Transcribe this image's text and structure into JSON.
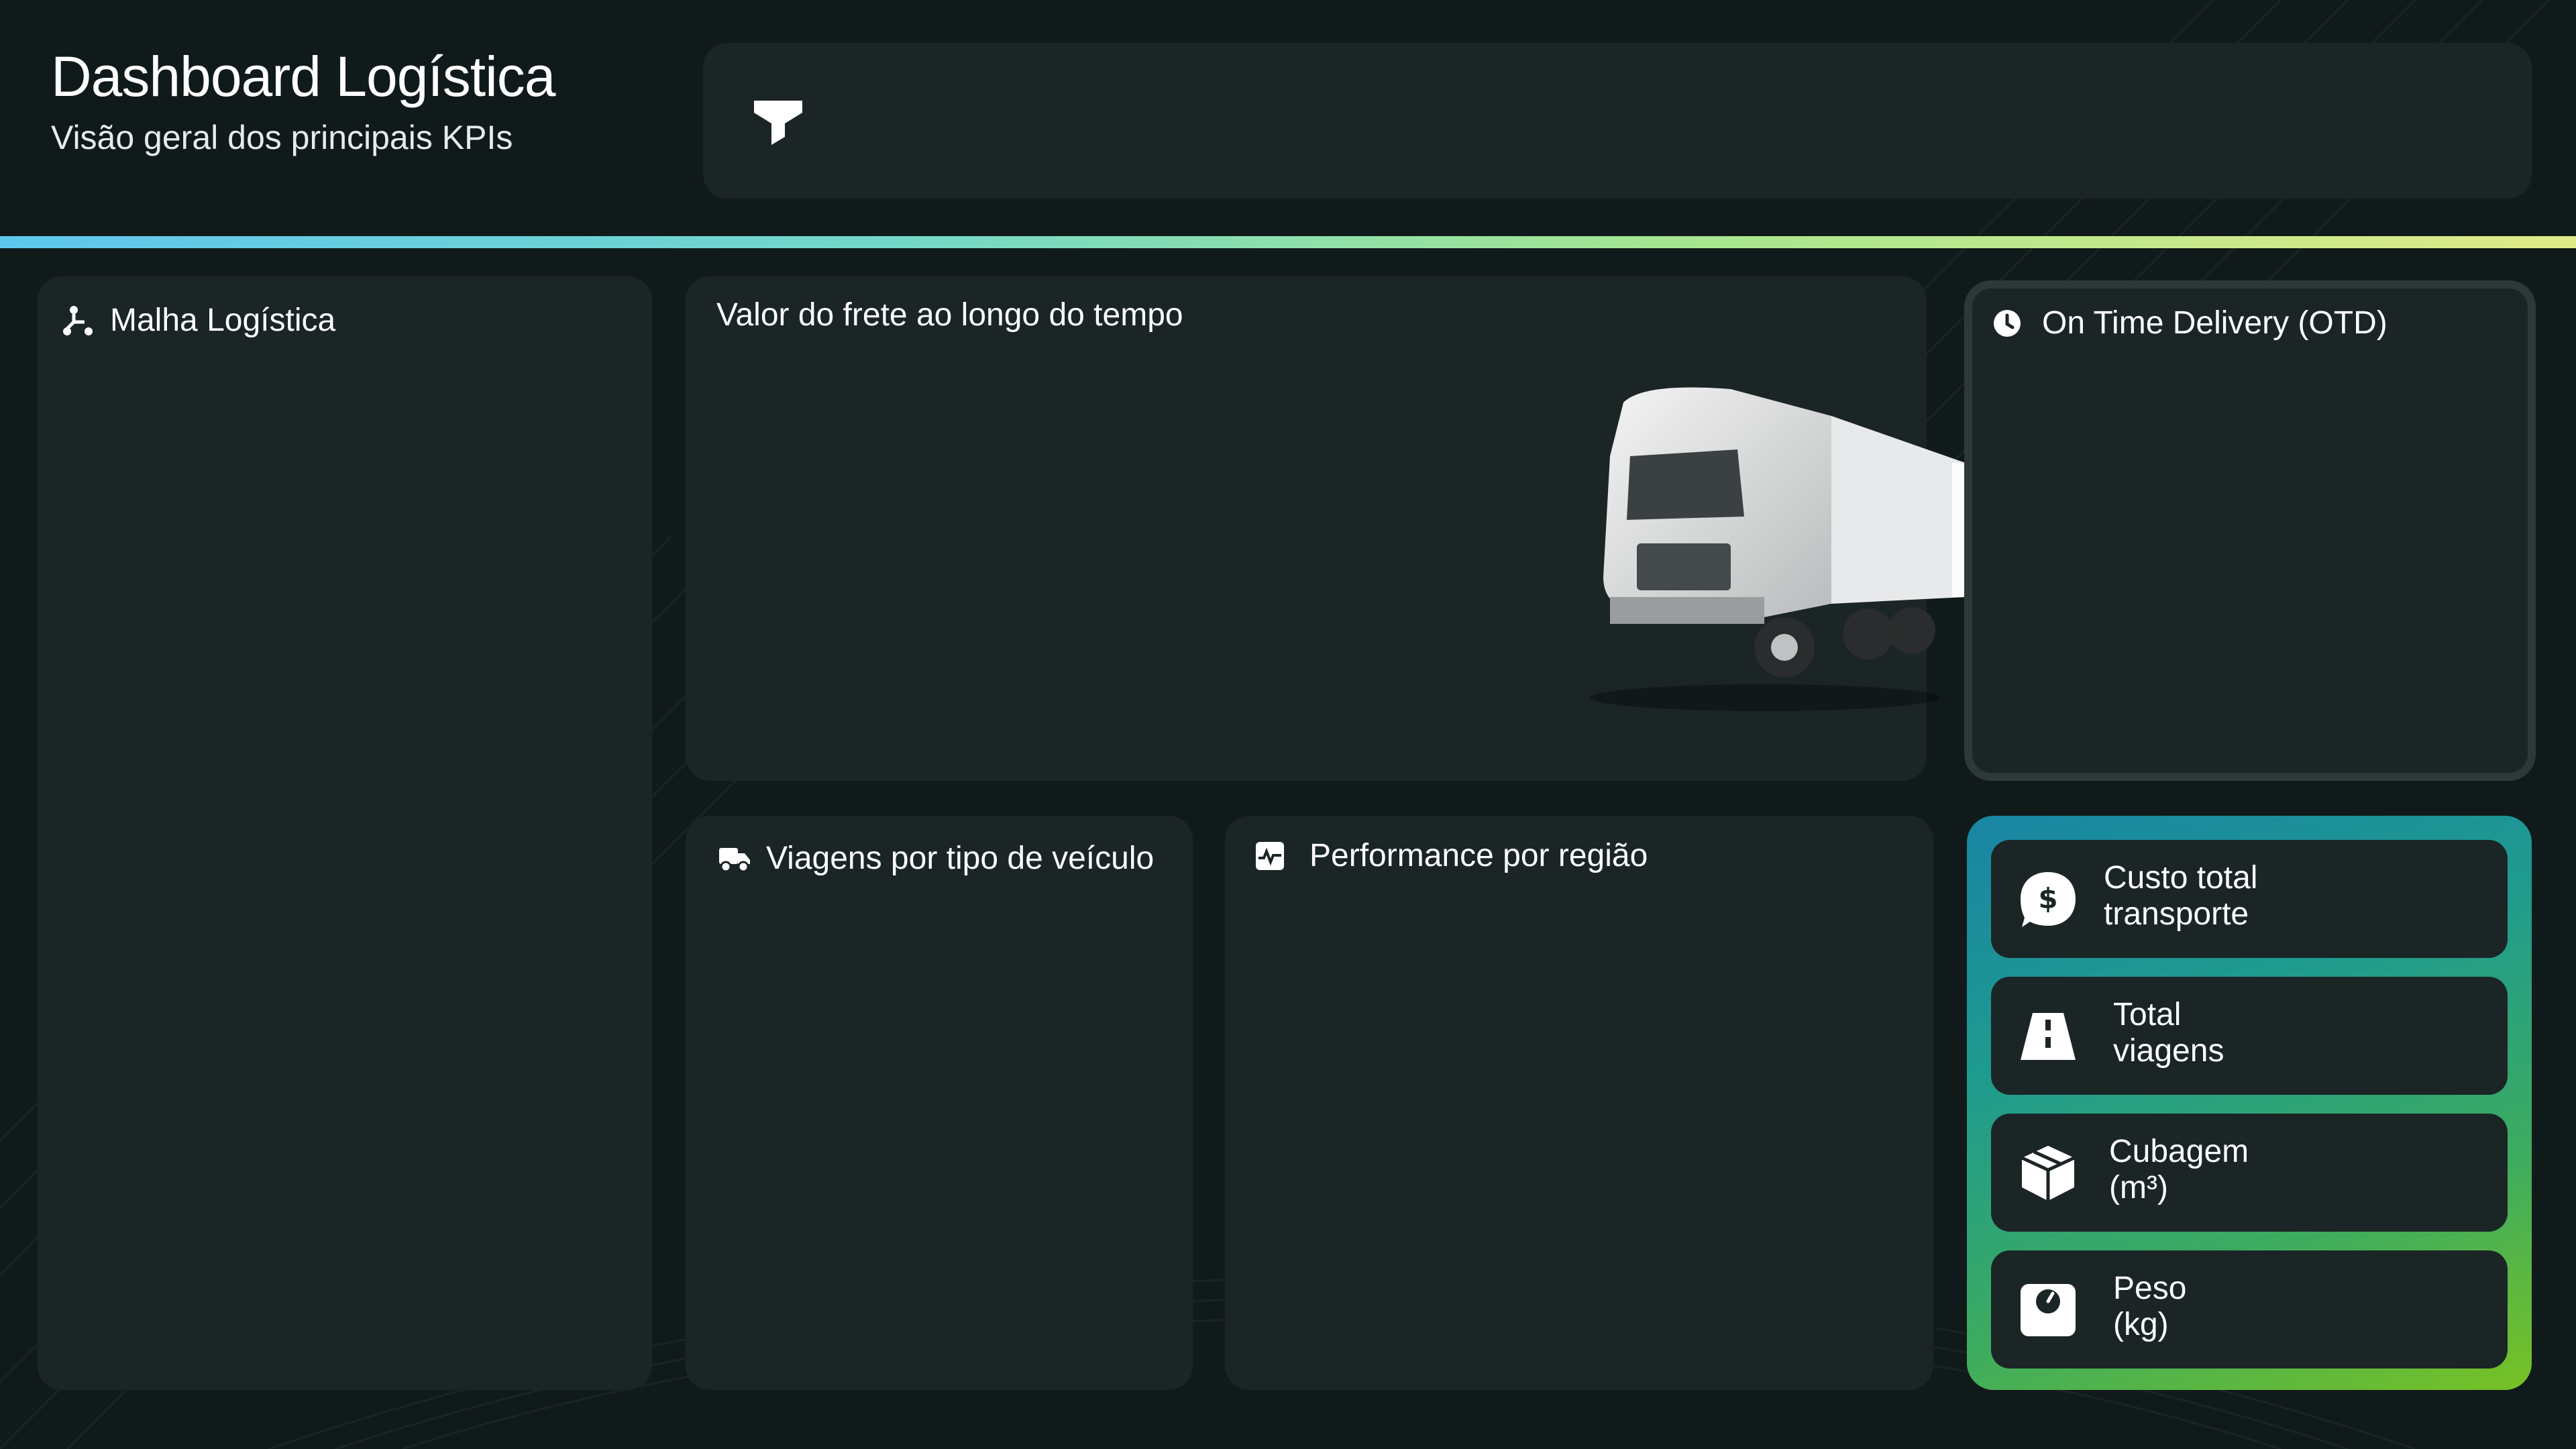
{
  "header": {
    "title": "Dashboard Logística",
    "subtitle": "Visão geral dos principais KPIs"
  },
  "filter_bar": {
    "icon": "filter-icon"
  },
  "panels": {
    "malha": {
      "title": "Malha Logística",
      "icon": "route-icon"
    },
    "frete": {
      "title": "Valor do frete ao longo do tempo"
    },
    "otd": {
      "title": "On Time Delivery (OTD)",
      "icon": "clock-icon"
    },
    "viagens": {
      "title": "Viagens por tipo de veículo",
      "icon": "truck-icon"
    },
    "performance": {
      "title": "Performance por região",
      "icon": "pulse-chart-icon"
    }
  },
  "kpis": [
    {
      "line1": "Custo total",
      "line2": "transporte",
      "icon": "dollar-badge-icon"
    },
    {
      "line1": "Total",
      "line2": "viagens",
      "icon": "road-icon"
    },
    {
      "line1": "Cubagem",
      "line2": "(m³)",
      "icon": "box-icon"
    },
    {
      "line1": "Peso",
      "line2": "(kg)",
      "icon": "scale-icon"
    }
  ],
  "colors": {
    "background": "#111a1a",
    "panel": "#1b2526",
    "accent_start": "#5fc7ee",
    "accent_end": "#e0ea88",
    "kpi_gradient_start": "#1985a4",
    "kpi_gradient_end": "#78c224"
  }
}
